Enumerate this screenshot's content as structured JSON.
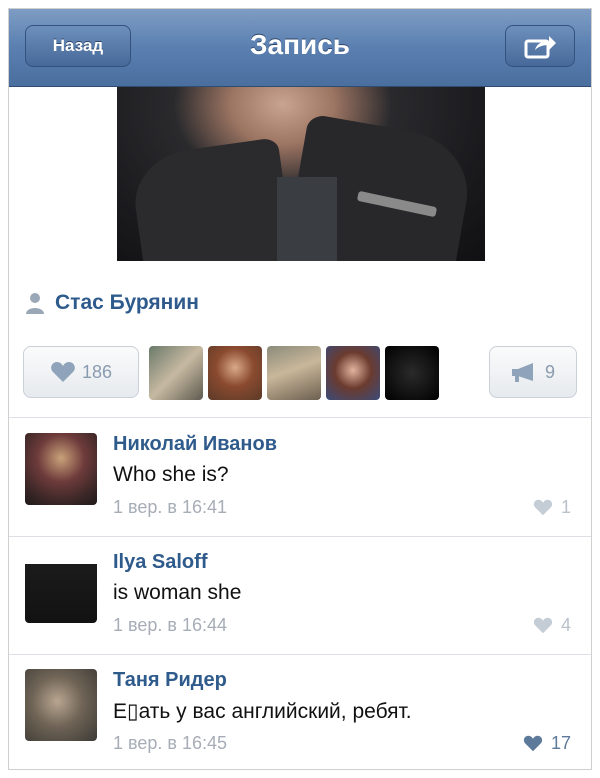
{
  "navbar": {
    "back_label": "Назад",
    "title": "Запись",
    "share_icon": "share-icon"
  },
  "post": {
    "author": "Стас Бурянин",
    "likes": "186",
    "reposts": "9",
    "liker_count_shown": 5
  },
  "comments": [
    {
      "name": "Николай Иванов",
      "text": "Who she is?",
      "time": "1 вер. в 16:41",
      "likes": "1"
    },
    {
      "name": "Ilya Saloff",
      "text": "is woman she",
      "time": "1 вер. в 16:44",
      "likes": "4"
    },
    {
      "name": "Таня Ридер",
      "text": "Е▯ать у вас английский, ребят.",
      "time": "1 вер. в 16:45",
      "likes": "17"
    }
  ],
  "colors": {
    "navbar": "#5a7fb0",
    "link": "#2f5b8c",
    "muted": "#a6adb6"
  }
}
